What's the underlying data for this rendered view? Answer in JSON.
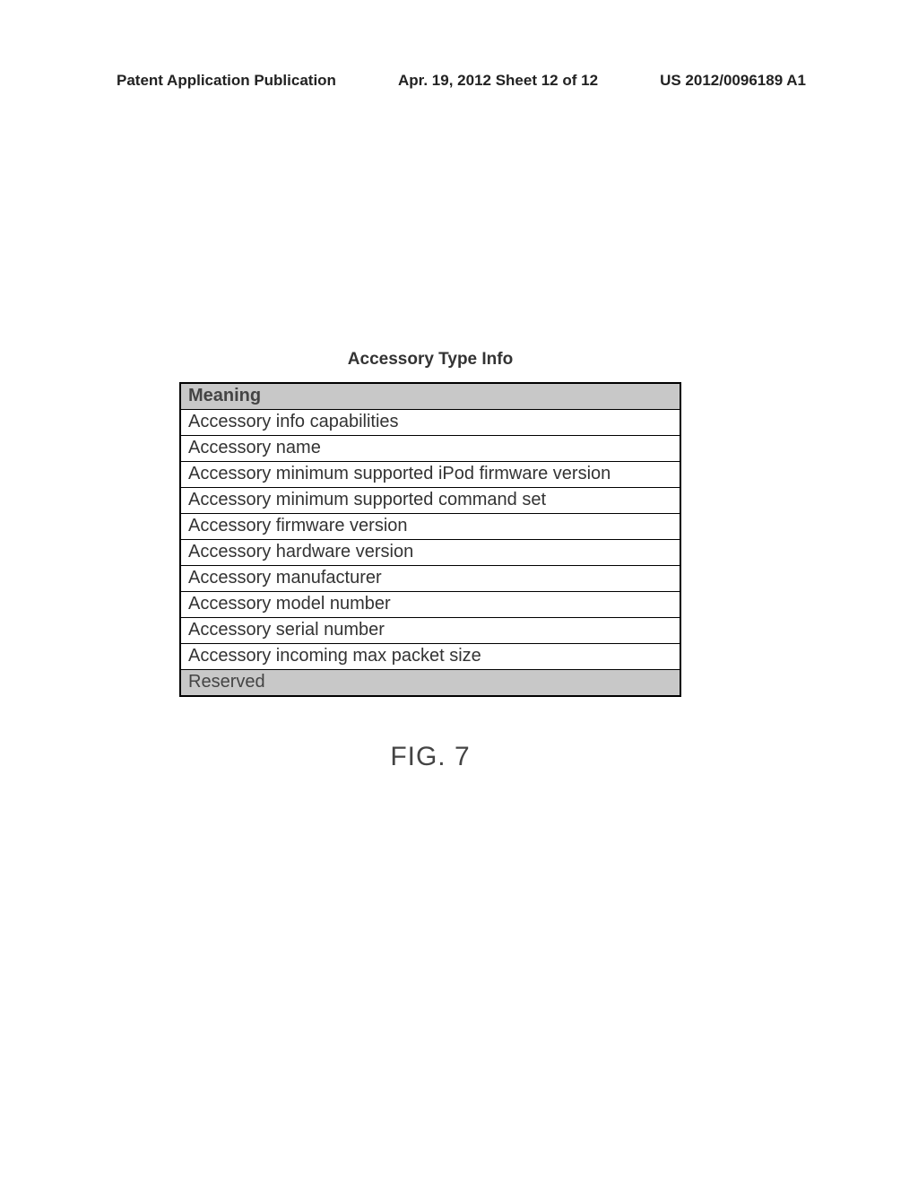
{
  "header": {
    "left": "Patent Application Publication",
    "center": "Apr. 19, 2012  Sheet 12 of 12",
    "right": "US 2012/0096189 A1"
  },
  "table": {
    "title": "Accessory Type Info",
    "header": "Meaning",
    "rows": [
      "Accessory info capabilities",
      "Accessory name",
      "Accessory minimum supported iPod firmware version",
      "Accessory minimum supported command set",
      "Accessory firmware version",
      "Accessory hardware version",
      "Accessory manufacturer",
      "Accessory model number",
      "Accessory serial number",
      "Accessory incoming max packet size"
    ],
    "footer": "Reserved"
  },
  "figure_label": "FIG. 7"
}
